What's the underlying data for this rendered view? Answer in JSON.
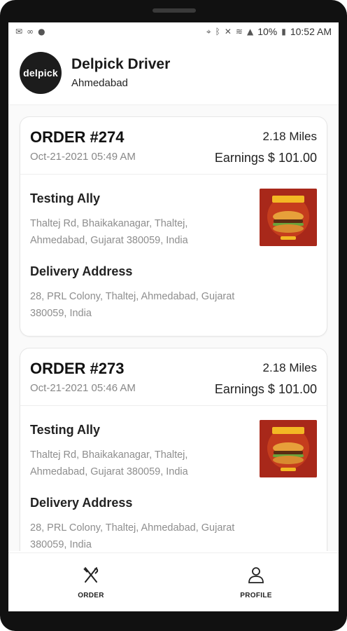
{
  "status_bar": {
    "left_icons": [
      "mail-icon",
      "voicemail-icon",
      "facebook-icon"
    ],
    "right_icons": [
      "location-icon",
      "bluetooth-icon",
      "mute-icon",
      "wifi-icon",
      "signal-icon",
      "battery-icon"
    ],
    "battery": "10%",
    "time": "10:52 AM"
  },
  "header": {
    "logo_text": "delpick",
    "title": "Delpick Driver",
    "subtitle": "Ahmedabad"
  },
  "orders": [
    {
      "order_no": "ORDER #274",
      "date": "Oct-21-2021 05:49 AM",
      "miles": "2.18 Miles",
      "earnings": "Earnings $ 101.00",
      "restaurant": "Testing Ally",
      "restaurant_address": "Thaltej Rd, Bhaikakanagar, Thaltej, Ahmedabad, Gujarat 380059, India",
      "delivery_label": "Delivery Address",
      "delivery_address": "28, PRL Colony, Thaltej, Ahmedabad, Gujarat 380059, India"
    },
    {
      "order_no": "ORDER #273",
      "date": "Oct-21-2021 05:46 AM",
      "miles": "2.18 Miles",
      "earnings": "Earnings $ 101.00",
      "restaurant": "Testing Ally",
      "restaurant_address": "Thaltej Rd, Bhaikakanagar, Thaltej, Ahmedabad, Gujarat 380059, India",
      "delivery_label": "Delivery Address",
      "delivery_address": "28, PRL Colony, Thaltej, Ahmedabad, Gujarat 380059, India"
    }
  ],
  "bottom_nav": {
    "order_label": "ORDER",
    "order_icon": "fork-knife-icon",
    "profile_label": "PROFILE",
    "profile_icon": "person-icon"
  }
}
